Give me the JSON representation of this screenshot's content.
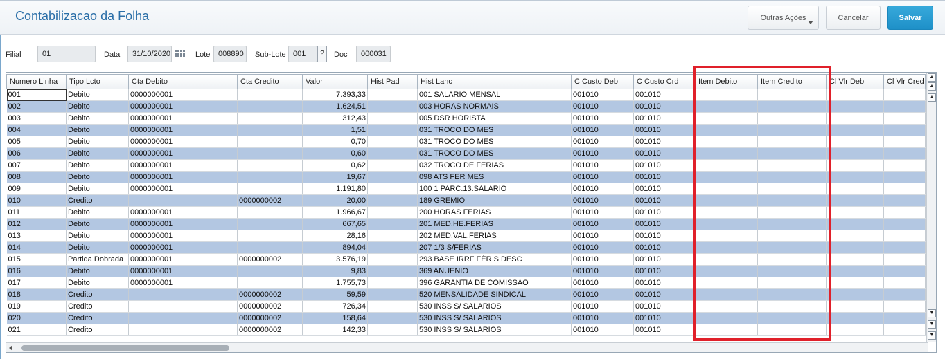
{
  "header": {
    "title": "Contabilizacao da Folha",
    "btn_outras": "Outras Ações",
    "btn_cancelar": "Cancelar",
    "btn_salvar": "Salvar"
  },
  "form": {
    "filial_label": "Filial",
    "filial_value": "01",
    "data_label": "Data",
    "data_value": "31/10/2020",
    "lote_label": "Lote",
    "lote_value": "008890",
    "sublote_label": "Sub-Lote",
    "sublote_value": "001",
    "help_label": "?",
    "doc_label": "Doc",
    "doc_value": "000031"
  },
  "grid": {
    "columns": [
      "Numero Linha",
      "Tipo Lcto",
      "Cta Debito",
      "Cta Credito",
      "Valor",
      "Hist Pad",
      "Hist Lanc",
      "C Custo Deb",
      "C Custo Crd",
      "Item Debito",
      "Item Credito",
      "Cl Vlr Deb",
      "Cl Vlr Cred"
    ],
    "rows": [
      [
        "001",
        "Debito",
        "0000000001",
        "",
        "7.393,33",
        "",
        "001 SALARIO MENSAL",
        "001010",
        "001010",
        "",
        "",
        "",
        ""
      ],
      [
        "002",
        "Debito",
        "0000000001",
        "",
        "1.624,51",
        "",
        "003 HORAS NORMAIS",
        "001010",
        "001010",
        "",
        "",
        "",
        ""
      ],
      [
        "003",
        "Debito",
        "0000000001",
        "",
        "312,43",
        "",
        "005 DSR HORISTA",
        "001010",
        "001010",
        "",
        "",
        "",
        ""
      ],
      [
        "004",
        "Debito",
        "0000000001",
        "",
        "1,51",
        "",
        "031 TROCO DO MES",
        "001010",
        "001010",
        "",
        "",
        "",
        ""
      ],
      [
        "005",
        "Debito",
        "0000000001",
        "",
        "0,70",
        "",
        "031 TROCO DO MES",
        "001010",
        "001010",
        "",
        "",
        "",
        ""
      ],
      [
        "006",
        "Debito",
        "0000000001",
        "",
        "0,60",
        "",
        "031 TROCO DO MES",
        "001010",
        "001010",
        "",
        "",
        "",
        ""
      ],
      [
        "007",
        "Debito",
        "0000000001",
        "",
        "0,62",
        "",
        "032 TROCO DE FERIAS",
        "001010",
        "001010",
        "",
        "",
        "",
        ""
      ],
      [
        "008",
        "Debito",
        "0000000001",
        "",
        "19,67",
        "",
        "098 ATS FER MES",
        "001010",
        "001010",
        "",
        "",
        "",
        ""
      ],
      [
        "009",
        "Debito",
        "0000000001",
        "",
        "1.191,80",
        "",
        "100 1 PARC.13.SALARIO",
        "001010",
        "001010",
        "",
        "",
        "",
        ""
      ],
      [
        "010",
        "Credito",
        "",
        "0000000002",
        "20,00",
        "",
        "189 GREMIO",
        "001010",
        "001010",
        "",
        "",
        "",
        ""
      ],
      [
        "011",
        "Debito",
        "0000000001",
        "",
        "1.966,67",
        "",
        "200 HORAS FERIAS",
        "001010",
        "001010",
        "",
        "",
        "",
        ""
      ],
      [
        "012",
        "Debito",
        "0000000001",
        "",
        "667,65",
        "",
        "201 MED.HE.FERIAS",
        "001010",
        "001010",
        "",
        "",
        "",
        ""
      ],
      [
        "013",
        "Debito",
        "0000000001",
        "",
        "28,16",
        "",
        "202 MED.VAL.FERIAS",
        "001010",
        "001010",
        "",
        "",
        "",
        ""
      ],
      [
        "014",
        "Debito",
        "0000000001",
        "",
        "894,04",
        "",
        "207 1/3 S/FERIAS",
        "001010",
        "001010",
        "",
        "",
        "",
        ""
      ],
      [
        "015",
        "Partida Dobrada",
        "0000000001",
        "0000000002",
        "3.576,19",
        "",
        "293 BASE IRRF FÉR S DESC",
        "001010",
        "001010",
        "",
        "",
        "",
        ""
      ],
      [
        "016",
        "Debito",
        "0000000001",
        "",
        "9,83",
        "",
        "369 ANUENIO",
        "001010",
        "001010",
        "",
        "",
        "",
        ""
      ],
      [
        "017",
        "Debito",
        "0000000001",
        "",
        "1.755,73",
        "",
        "396 GARANTIA DE COMISSAO",
        "001010",
        "001010",
        "",
        "",
        "",
        ""
      ],
      [
        "018",
        "Credito",
        "",
        "0000000002",
        "59,59",
        "",
        "520 MENSALIDADE SINDICAL",
        "001010",
        "001010",
        "",
        "",
        "",
        ""
      ],
      [
        "019",
        "Credito",
        "",
        "0000000002",
        "726,34",
        "",
        "530 INSS S/ SALARIOS",
        "001010",
        "001010",
        "",
        "",
        "",
        ""
      ],
      [
        "020",
        "Credito",
        "",
        "0000000002",
        "158,64",
        "",
        "530 INSS S/ SALARIOS",
        "001010",
        "001010",
        "",
        "",
        "",
        ""
      ],
      [
        "021",
        "Credito",
        "",
        "0000000002",
        "142,33",
        "",
        "530 INSS S/ SALARIOS",
        "001010",
        "001010",
        "",
        "",
        "",
        ""
      ]
    ]
  },
  "colors": {
    "accent": "#2b6fa8",
    "alt_row": "#b3c7e2",
    "highlight": "#e0202a",
    "save_button": "#1e90c8"
  }
}
